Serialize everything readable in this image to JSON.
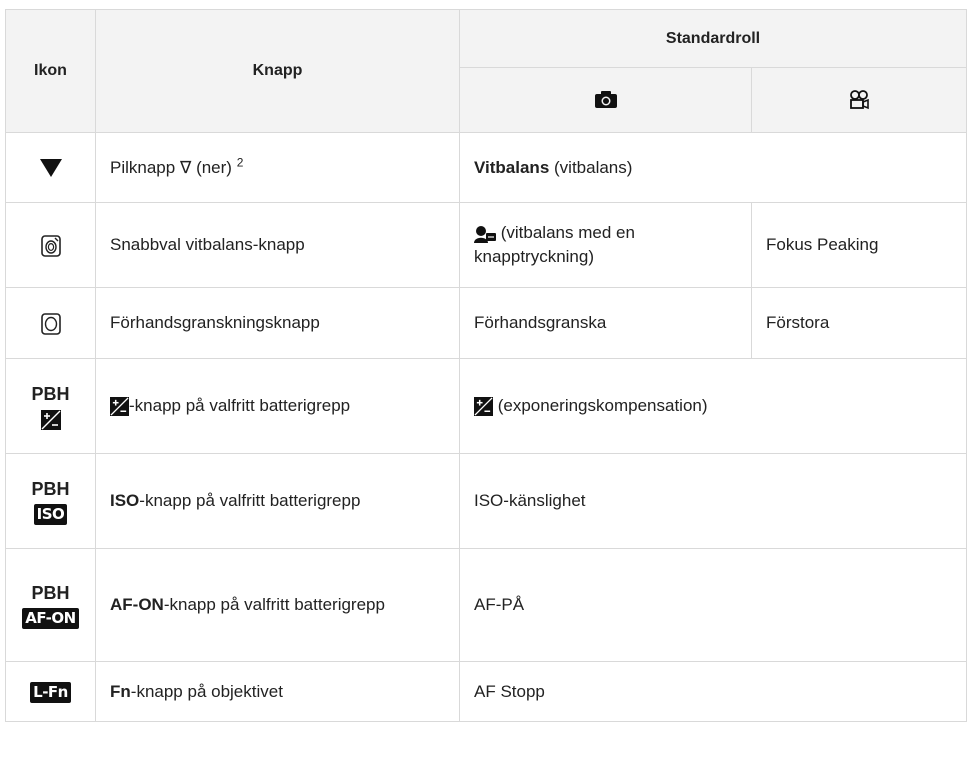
{
  "headers": {
    "ikon": "Ikon",
    "knapp": "Knapp",
    "standardroll": "Standardroll"
  },
  "icons": {
    "photo_mode": "camera-icon",
    "video_mode": "movie-camera-icon",
    "down": "down-triangle-icon",
    "wb_button": "one-touch-wb-button-icon",
    "preview_button": "preview-button-icon",
    "exposure": "exposure-compensation-icon",
    "one_touch_wb": "one-touch-wb-icon"
  },
  "rows": [
    {
      "knapp_main": "Pilknapp",
      "knapp_symbol": "∇",
      "knapp_rest": "(ner)",
      "knapp_sup": "2",
      "roll_bold": "Vitbalans",
      "roll_rest": " (vitbalans)"
    },
    {
      "knapp": "Snabbval vitbalans-knapp",
      "roll_photo": " (vitbalans med en knapptryckning)",
      "roll_video": "Fokus Peaking"
    },
    {
      "knapp": "Förhandsgranskningsknapp",
      "roll_photo": "Förhandsgranska",
      "roll_video": "Förstora"
    },
    {
      "ikon_top": "PBH",
      "knapp": "-knapp på valfritt batterigrepp",
      "roll": " (exponeringskompensation)"
    },
    {
      "ikon_top": "PBH",
      "ikon_badge": "ISO",
      "knapp_bold": "ISO",
      "knapp_rest": "-knapp på valfritt batterigrepp",
      "roll": "ISO-känslighet"
    },
    {
      "ikon_top": "PBH",
      "ikon_badge": "AF-ON",
      "knapp_bold": "AF-ON",
      "knapp_rest": "-knapp på valfritt batterigrepp",
      "roll": "AF-PÅ"
    },
    {
      "ikon_badge": "L-Fn",
      "knapp_bold": "Fn",
      "knapp_rest": "-knapp på objektivet",
      "roll": "AF Stopp"
    }
  ]
}
